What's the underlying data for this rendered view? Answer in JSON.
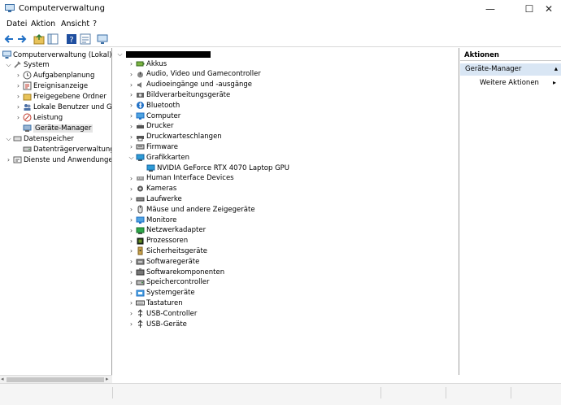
{
  "window": {
    "title": "Computerverwaltung",
    "min_glyph": "—",
    "max_glyph": "☐",
    "close_glyph": "✕"
  },
  "menu": [
    "Datei",
    "Aktion",
    "Ansicht",
    "?"
  ],
  "left_tree": {
    "root": "Computerverwaltung (Lokal)",
    "system": "System",
    "system_items": [
      "Aufgabenplanung",
      "Ereignisanzeige",
      "Freigegebene Ordner",
      "Lokale Benutzer und Gr",
      "Leistung",
      "Geräte-Manager"
    ],
    "storage": "Datenspeicher",
    "storage_items": [
      "Datenträgerverwaltung"
    ],
    "services": "Dienste und Anwendungen"
  },
  "devices": [
    "Akkus",
    "Audio, Video und Gamecontroller",
    "Audioeingänge und -ausgänge",
    "Bildverarbeitungsgeräte",
    "Bluetooth",
    "Computer",
    "Drucker",
    "Druckwarteschlangen",
    "Firmware",
    "Grafikkarten",
    "NVIDIA GeForce RTX 4070 Laptop GPU",
    "Human Interface Devices",
    "Kameras",
    "Laufwerke",
    "Mäuse und andere Zeigegeräte",
    "Monitore",
    "Netzwerkadapter",
    "Prozessoren",
    "Sicherheitsgeräte",
    "Softwaregeräte",
    "Softwarekomponenten",
    "Speichercontroller",
    "Systemgeräte",
    "Tastaturen",
    "USB-Controller",
    "USB-Geräte"
  ],
  "actions": {
    "header": "Aktionen",
    "section": "Geräte-Manager",
    "more": "Weitere Aktionen",
    "section_arrow": "▴",
    "more_arrow": "▸"
  },
  "colors": {
    "selection": "#d9e6f4",
    "accent": "#1f6fc5"
  }
}
